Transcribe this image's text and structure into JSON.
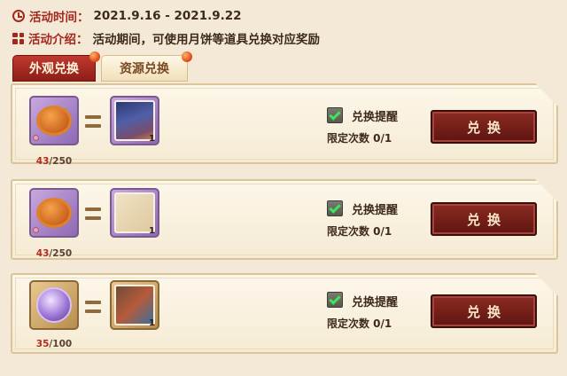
{
  "event": {
    "time_label": "活动时间：",
    "time_value": "2021.9.16 - 2021.9.22",
    "intro_label": "活动介绍：",
    "intro_value": "活动期间，可使用月饼等道具兑换对应奖励"
  },
  "tabs": [
    {
      "label": "外观兑换",
      "active": true
    },
    {
      "label": "资源兑换",
      "active": false
    }
  ],
  "rows": [
    {
      "cost_item": "mooncake-icon",
      "cost_current": "43",
      "cost_total": "/250",
      "reward_item": "night-scene-picture",
      "reward_qty": "1",
      "remind_label": "兑换提醒",
      "limit_text": "限定次数 0/1",
      "button_label": "兑换"
    },
    {
      "cost_item": "mooncake-icon",
      "cost_current": "43",
      "cost_total": "/250",
      "reward_item": "letter-picture",
      "reward_qty": "1",
      "remind_label": "兑换提醒",
      "limit_text": "限定次数 0/1",
      "button_label": "兑换"
    },
    {
      "cost_item": "emblem-icon",
      "cost_current": "35",
      "cost_total": "/100",
      "reward_item": "gift-picture",
      "reward_qty": "1",
      "remind_label": "兑换提醒",
      "limit_text": "限定次数 0/1",
      "button_label": "兑换"
    }
  ],
  "colors": {
    "accent_red": "#a3281f",
    "button_red": "#6e1b14",
    "background": "#f3e9d6",
    "check_green": "#3fe35b"
  }
}
